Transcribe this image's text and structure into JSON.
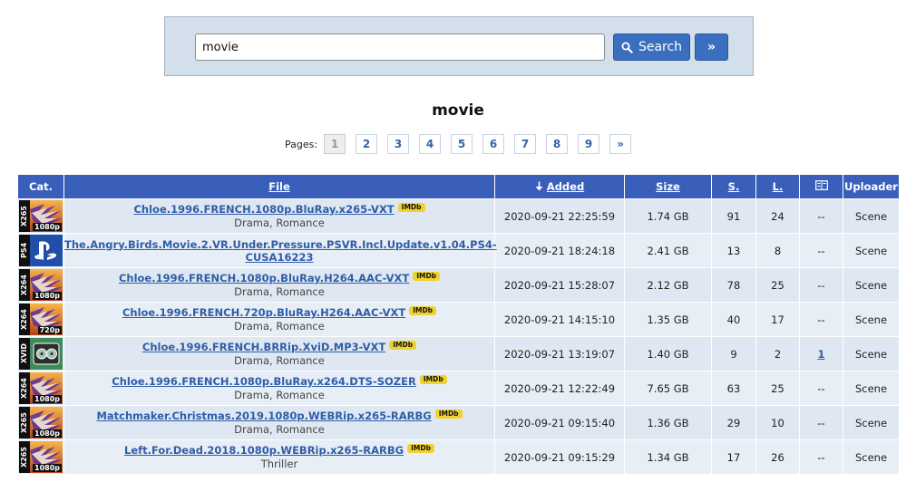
{
  "search": {
    "value": "movie",
    "button_label": "Search",
    "more_label": "»"
  },
  "page_title": "movie",
  "pagination": {
    "label": "Pages:",
    "pages": [
      "1",
      "2",
      "3",
      "4",
      "5",
      "6",
      "7",
      "8",
      "9"
    ],
    "current": "1",
    "next_label": "»"
  },
  "table": {
    "columns": {
      "cat": "Cat.",
      "file": "File",
      "added": "Added",
      "size": "Size",
      "seeders": "S.",
      "leechers": "L.",
      "comments": "",
      "uploader": "Uploader"
    },
    "rows": [
      {
        "cat": "X265",
        "res": "1080p",
        "art": "flame",
        "title": "Chloe.1996.FRENCH.1080p.BluRay.x265-VXT",
        "imdb": "IMDb",
        "genre": "Drama, Romance",
        "added": "2020-09-21 22:25:59",
        "size": "1.74 GB",
        "seeders": "91",
        "seed_color": "green",
        "leechers": "24",
        "comments": "--",
        "uploader": "Scene"
      },
      {
        "cat": "PS4",
        "res": "",
        "art": "ps",
        "title": "The.Angry.Birds.Movie.2.VR.Under.Pressure.PSVR.Incl.Update.v1.04.PS4-CUSA16223",
        "imdb": "",
        "genre": "",
        "added": "2020-09-21 18:24:18",
        "size": "2.41 GB",
        "seeders": "13",
        "seed_color": "red",
        "leechers": "8",
        "comments": "--",
        "uploader": "Scene"
      },
      {
        "cat": "X264",
        "res": "1080p",
        "art": "flame",
        "title": "Chloe.1996.FRENCH.1080p.BluRay.H264.AAC-VXT",
        "imdb": "IMDb",
        "genre": "Drama, Romance",
        "added": "2020-09-21 15:28:07",
        "size": "2.12 GB",
        "seeders": "78",
        "seed_color": "green",
        "leechers": "25",
        "comments": "--",
        "uploader": "Scene"
      },
      {
        "cat": "X264",
        "res": "720p",
        "art": "flame",
        "title": "Chloe.1996.FRENCH.720p.BluRay.H264.AAC-VXT",
        "imdb": "IMDb",
        "genre": "Drama, Romance",
        "added": "2020-09-21 14:15:10",
        "size": "1.35 GB",
        "seeders": "40",
        "seed_color": "green",
        "leechers": "17",
        "comments": "--",
        "uploader": "Scene"
      },
      {
        "cat": "XVID",
        "res": "",
        "art": "film",
        "title": "Chloe.1996.FRENCH.BRRip.XviD.MP3-VXT",
        "imdb": "IMDb",
        "genre": "Drama, Romance",
        "added": "2020-09-21 13:19:07",
        "size": "1.40 GB",
        "seeders": "9",
        "seed_color": "red",
        "leechers": "2",
        "comments": "1",
        "uploader": "Scene"
      },
      {
        "cat": "X264",
        "res": "1080p",
        "art": "flame",
        "title": "Chloe.1996.FRENCH.1080p.BluRay.x264.DTS-SOZER",
        "imdb": "IMDb",
        "genre": "Drama, Romance",
        "added": "2020-09-21 12:22:49",
        "size": "7.65 GB",
        "seeders": "63",
        "seed_color": "green",
        "leechers": "25",
        "comments": "--",
        "uploader": "Scene"
      },
      {
        "cat": "X265",
        "res": "1080p",
        "art": "flame",
        "title": "Matchmaker.Christmas.2019.1080p.WEBRip.x265-RARBG",
        "imdb": "IMDb",
        "genre": "Drama, Romance",
        "added": "2020-09-21 09:15:40",
        "size": "1.36 GB",
        "seeders": "29",
        "seed_color": "green",
        "leechers": "10",
        "comments": "--",
        "uploader": "Scene"
      },
      {
        "cat": "X265",
        "res": "1080p",
        "art": "flame",
        "title": "Left.For.Dead.2018.1080p.WEBRip.x265-RARBG",
        "imdb": "IMDb",
        "genre": "Thriller",
        "added": "2020-09-21 09:15:29",
        "size": "1.34 GB",
        "seeders": "17",
        "seed_color": "red",
        "leechers": "26",
        "comments": "--",
        "uploader": "Scene"
      }
    ]
  },
  "colors": {
    "header_bg": "#3a5fba",
    "link": "#2f5da8",
    "seed_green": "#2b8f2b",
    "seed_red": "#cc2b2b",
    "imdb_badge": "#f1d22d"
  }
}
